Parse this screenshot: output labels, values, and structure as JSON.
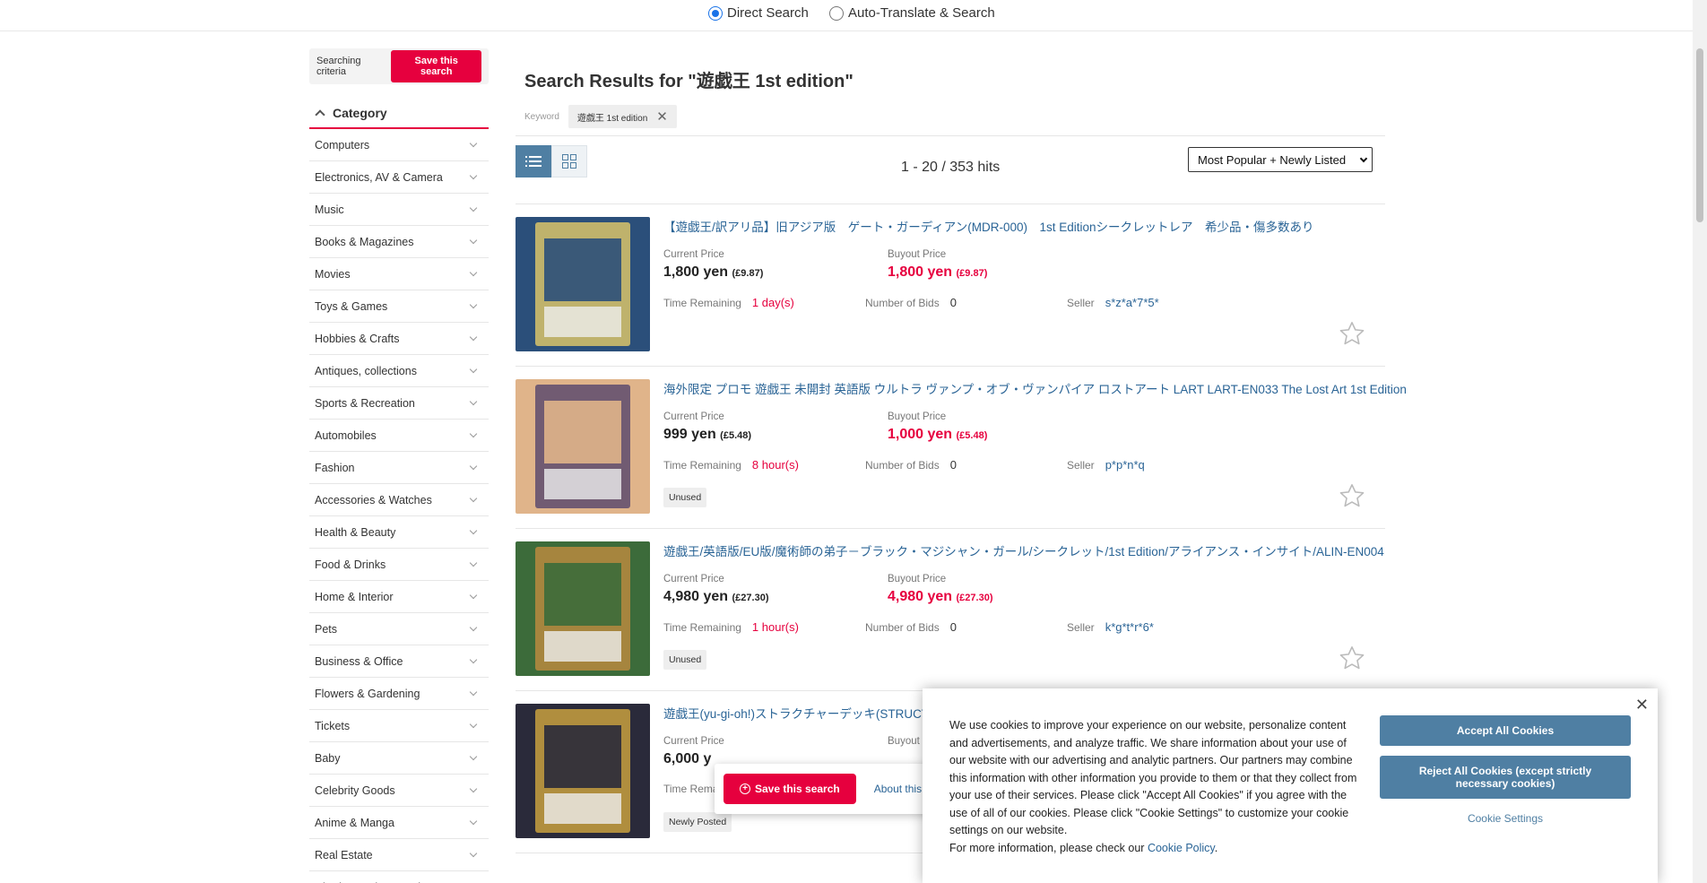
{
  "search_mode": {
    "options": [
      {
        "label": "Direct Search",
        "selected": true
      },
      {
        "label": "Auto-Translate & Search",
        "selected": false
      }
    ]
  },
  "sidebar": {
    "criteria_label": "Searching criteria",
    "save_label": "Save this search",
    "category_title": "Category",
    "categories": [
      "Computers",
      "Electronics, AV & Camera",
      "Music",
      "Books & Magazines",
      "Movies",
      "Toys & Games",
      "Hobbies & Crafts",
      "Antiques, collections",
      "Sports & Recreation",
      "Automobiles",
      "Fashion",
      "Accessories & Watches",
      "Health & Beauty",
      "Food & Drinks",
      "Home & Interior",
      "Pets",
      "Business & Office",
      "Flowers & Gardening",
      "Tickets",
      "Baby",
      "Celebrity Goods",
      "Anime & Manga",
      "Real Estate",
      "Charity Auction Goods"
    ]
  },
  "main": {
    "title": "Search Results for \"遊戯王 1st edition\"",
    "keyword_label": "Keyword",
    "keyword_value": "遊戯王 1st edition",
    "hits": "1 - 20 / 353 hits",
    "sort_value": "Most Popular + Newly Listed",
    "labels": {
      "current_price": "Current Price",
      "buyout_price": "Buyout Price",
      "time_remaining": "Time Remaining",
      "number_of_bids": "Number of Bids",
      "seller": "Seller"
    },
    "items": [
      {
        "title": "【遊戯王/訳アリ品】旧アジア版　ゲート・ガーディアン(MDR-000)　1st Editionシークレットレア　希少品・傷多数あり",
        "current_price": "1,800 yen",
        "current_gbp": "(£9.87)",
        "buyout_price": "1,800 yen",
        "buyout_gbp": "(£9.87)",
        "time_remaining": "1 day(s)",
        "bids": "0",
        "seller": "s*z*a*7*5*",
        "badge": "",
        "colors": [
          "#2b4f7a",
          "#d9c36a"
        ]
      },
      {
        "title": "海外限定 プロモ 遊戯王 未開封 英語版 ウルトラ ヴァンプ・オブ・ヴァンパイア ロストアート LART LART-EN033 The Lost Art 1st Edition",
        "current_price": "999 yen",
        "current_gbp": "(£5.48)",
        "buyout_price": "1,000 yen",
        "buyout_gbp": "(£5.48)",
        "time_remaining": "8 hour(s)",
        "bids": "0",
        "seller": "p*p*n*q",
        "badge": "Unused",
        "colors": [
          "#e0b48a",
          "#5d4b6d"
        ]
      },
      {
        "title": "遊戯王/英語版/EU版/魔術師の弟子－ブラック・マジシャン・ガール/シークレット/1st Edition/アライアンス・インサイト/ALIN-EN004",
        "current_price": "4,980 yen",
        "current_gbp": "(£27.30)",
        "buyout_price": "4,980 yen",
        "buyout_gbp": "(£27.30)",
        "time_remaining": "1 hour(s)",
        "bids": "0",
        "seller": "k*g*t*r*6*",
        "badge": "Unused",
        "colors": [
          "#3c6b3a",
          "#b8893f"
        ]
      },
      {
        "title": "遊戯王(yu-gi-oh!)ストラクチャーデッキ(STRUCT",
        "current_price": "6,000 y",
        "current_gbp": "",
        "buyout_price": "",
        "buyout_gbp": "",
        "time_remaining": "",
        "bids": "",
        "seller": "",
        "badge": "Newly Posted",
        "colors": [
          "#2a2a3a",
          "#c8a040"
        ]
      }
    ],
    "item_labels_partial": {
      "buyout": "Buyout",
      "time_partial": "Time Remai"
    }
  },
  "float_save": {
    "button": "Save this search",
    "about": "About this"
  },
  "cookie": {
    "text": "We use cookies to improve your experience on our website, personalize content and advertisements, and analyze traffic. We share information about your use of our website with our advertising and analytic partners. Our partners may combine this information with other information you provide to them or that they collect from your use of their services. Please click \"Accept All Cookies\" if you agree with the use of all of our cookies. Please click \"Cookie Settings\" to customize your cookie settings on our website.",
    "more_prefix": "For more information, please check our ",
    "policy_link": "Cookie Policy",
    "more_suffix": ".",
    "accept": "Accept All Cookies",
    "reject": "Reject All Cookies (except strictly necessary cookies)",
    "settings": "Cookie Settings"
  }
}
